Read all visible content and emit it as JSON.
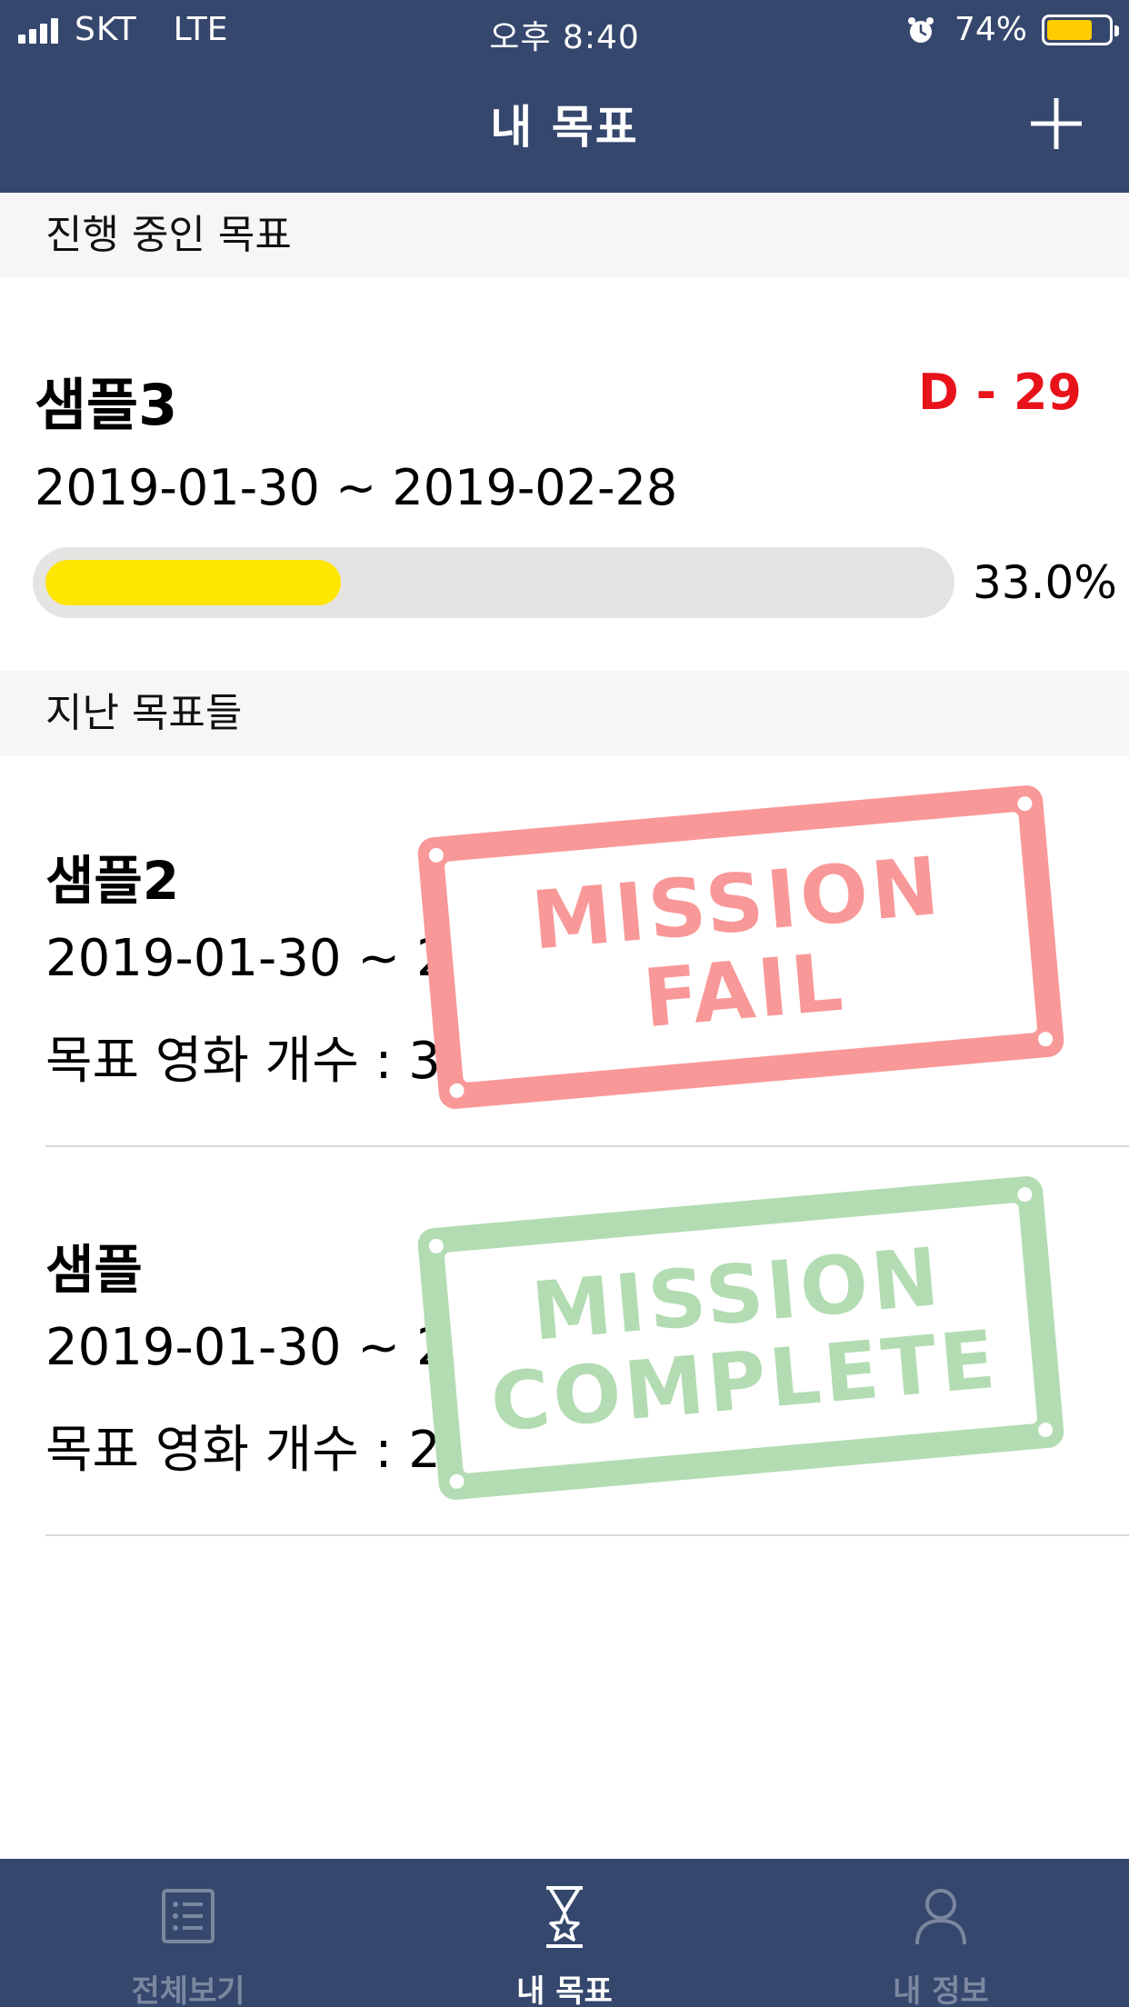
{
  "status_bar": {
    "carrier": "SKT",
    "network": "LTE",
    "time": "오후 8:40",
    "battery_percent_label": "74%",
    "battery_level": 0.74,
    "battery_color": "#ffcc00"
  },
  "nav": {
    "title": "내 목표",
    "add_icon": "plus-icon"
  },
  "sections": {
    "current_header": "진행 중인 목표",
    "past_header": "지난 목표들"
  },
  "current_goal": {
    "name": "샘플3",
    "dday": "D - 29",
    "dates": "2019-01-30 ~ 2019-02-28",
    "progress_label": "33.0%",
    "progress": 0.33,
    "progress_color": "#ffe600"
  },
  "past_goals": [
    {
      "name": "샘플2",
      "dates": "2019-01-30 ~ 2019-01-30",
      "count": "목표 영화 개수 : 3",
      "stamp_line1": "MISSION",
      "stamp_line2": "FAIL",
      "stamp_color": "#f99898"
    },
    {
      "name": "샘플",
      "dates": "2019-01-30 ~ 2019-01-31",
      "count": "목표 영화 개수 : 2",
      "stamp_line1": "MISSION",
      "stamp_line2": "COMPLETE",
      "stamp_color": "#b3dcb3"
    }
  ],
  "tabs": [
    {
      "label": "전체보기",
      "icon": "list-icon",
      "active": false
    },
    {
      "label": "내 목표",
      "icon": "hourglass-star-icon",
      "active": true
    },
    {
      "label": "내 정보",
      "icon": "person-icon",
      "active": false
    }
  ],
  "colors": {
    "nav_bg": "#35476d",
    "dday": "#e8121a",
    "tab_active": "#ffffff",
    "tab_inactive": "#7a879f"
  }
}
